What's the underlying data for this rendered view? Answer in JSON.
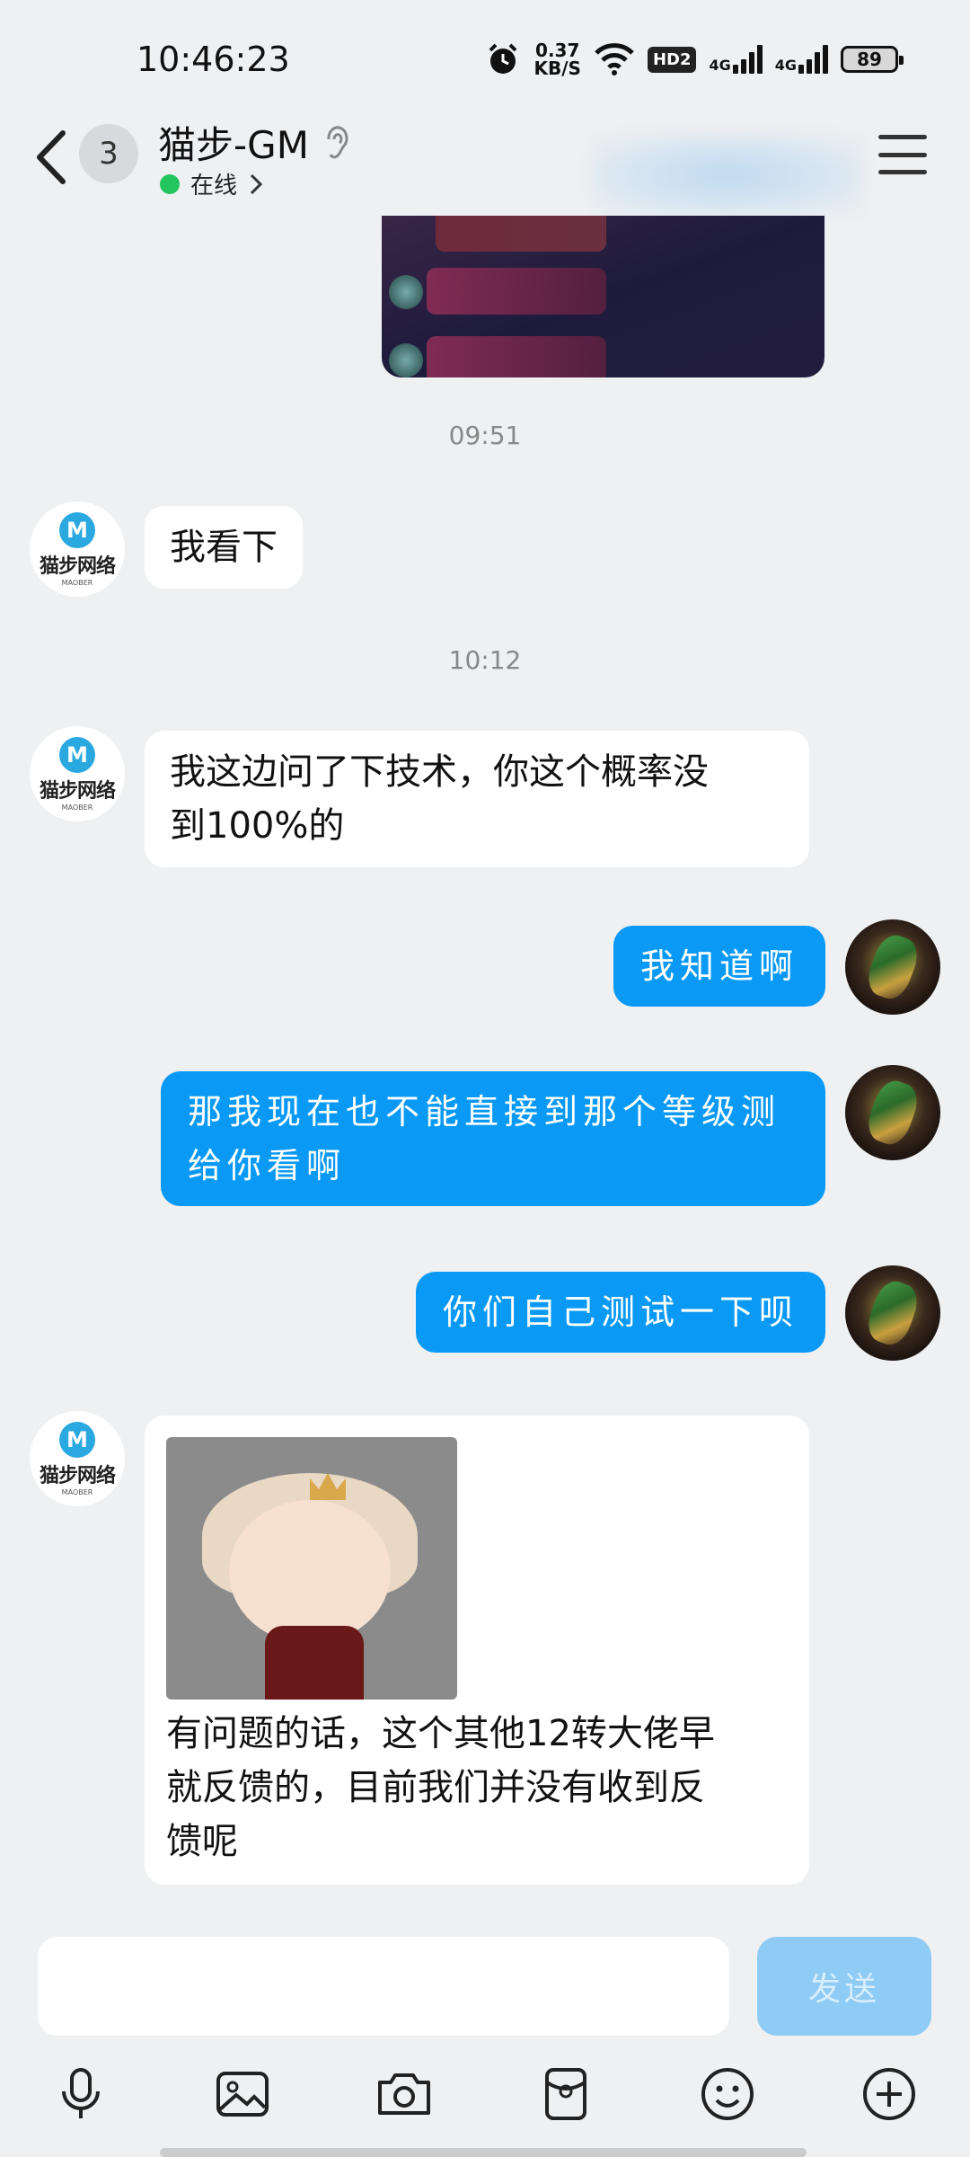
{
  "status_bar": {
    "time": "10:46:23",
    "speed_value": "0.37",
    "speed_unit": "KB/S",
    "hd_badge": "HD2",
    "network_1": "4G",
    "network_2": "4G",
    "battery": "89"
  },
  "header": {
    "unread_count": "3",
    "contact_name": "猫步-GM",
    "status_text": "在线"
  },
  "avatar_gm": {
    "logo_letter": "M",
    "logo_text": "猫步网络",
    "logo_sub": "MAOBER"
  },
  "messages": {
    "ts_1": "09:51",
    "m1": "我看下",
    "ts_2": "10:12",
    "m2_line1": "我这边问了下技术，你这个概率没",
    "m2_line2": "到100%的",
    "m3": "我知道啊",
    "m4_line1": "那我现在也不能直接到那个等级测",
    "m4_line2": "给你看啊",
    "m5": "你们自己测试一下呗",
    "m6_line1": "有问题的话，这个其他12转大佬早",
    "m6_line2": "就反馈的，目前我们并没有收到反",
    "m6_line3": "馈呢"
  },
  "input": {
    "value": "",
    "send_label": "发送"
  },
  "icons": {
    "back": "chevron-left-icon",
    "ear": "ear-icon",
    "menu": "menu-icon",
    "toolbar": [
      "microphone-icon",
      "image-icon",
      "camera-icon",
      "red-packet-icon",
      "emoji-icon",
      "plus-icon"
    ]
  },
  "colors": {
    "accent_blue": "#0a99f5",
    "send_disabled": "#8ecbf5",
    "online_green": "#22c55e",
    "background": "#eef0f2"
  }
}
